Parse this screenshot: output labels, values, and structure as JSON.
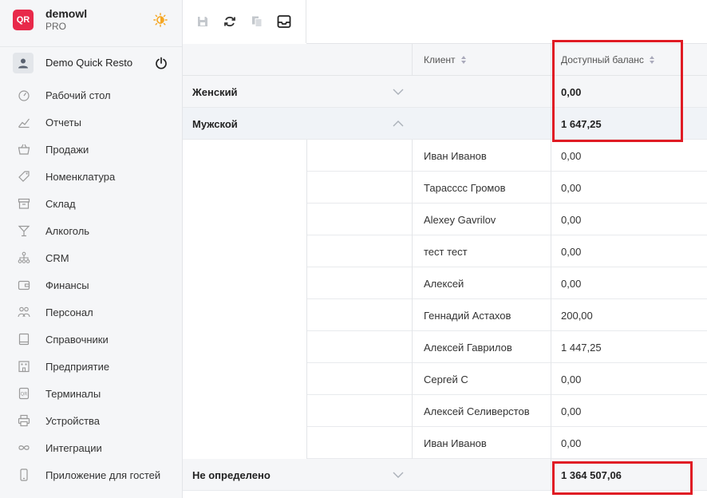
{
  "brand": {
    "logo_text": "QR",
    "name": "demowl",
    "plan": "PRO"
  },
  "user": {
    "name": "Demo Quick Resto"
  },
  "nav": [
    {
      "label": "Рабочий стол",
      "icon": "dashboard-icon"
    },
    {
      "label": "Отчеты",
      "icon": "chart-icon"
    },
    {
      "label": "Продажи",
      "icon": "basket-icon"
    },
    {
      "label": "Номенклатура",
      "icon": "tag-icon"
    },
    {
      "label": "Склад",
      "icon": "archive-icon"
    },
    {
      "label": "Алкоголь",
      "icon": "cocktail-icon"
    },
    {
      "label": "CRM",
      "icon": "people-tree-icon"
    },
    {
      "label": "Финансы",
      "icon": "wallet-icon"
    },
    {
      "label": "Персонал",
      "icon": "staff-icon"
    },
    {
      "label": "Справочники",
      "icon": "book-icon"
    },
    {
      "label": "Предприятие",
      "icon": "building-icon"
    },
    {
      "label": "Терминалы",
      "icon": "terminal-icon"
    },
    {
      "label": "Устройства",
      "icon": "printer-icon"
    },
    {
      "label": "Интеграции",
      "icon": "infinity-icon"
    },
    {
      "label": "Приложение для гостей",
      "icon": "phone-icon"
    }
  ],
  "toolbar": [
    "save-icon",
    "refresh-icon",
    "copy-icon",
    "inbox-icon"
  ],
  "columns": {
    "client": "Клиент",
    "balance": "Доступный баланс"
  },
  "groups": [
    {
      "name": "Женский",
      "balance": "0,00",
      "expanded": false,
      "rows": []
    },
    {
      "name": "Мужской",
      "balance": "1 647,25",
      "expanded": true,
      "rows": [
        {
          "client": "Иван Иванов",
          "balance": "0,00"
        },
        {
          "client": "Тарасссс Громов",
          "balance": "0,00"
        },
        {
          "client": "Alexey Gavrilov",
          "balance": "0,00"
        },
        {
          "client": "тест тест",
          "balance": "0,00"
        },
        {
          "client": "Алексей",
          "balance": "0,00"
        },
        {
          "client": "Геннадий Астахов",
          "balance": "200,00"
        },
        {
          "client": "Алексей Гаврилов",
          "balance": "1 447,25"
        },
        {
          "client": "Сергей С",
          "balance": "0,00"
        },
        {
          "client": "Алексей Селиверстов",
          "balance": "0,00"
        },
        {
          "client": "Иван Иванов",
          "balance": "0,00"
        }
      ]
    },
    {
      "name": "Не определено",
      "balance": "1 364 507,06",
      "expanded": false,
      "rows": []
    }
  ],
  "colors": {
    "brand": "#e8294a",
    "highlight": "#e01b24",
    "sun": "#f5a623"
  }
}
